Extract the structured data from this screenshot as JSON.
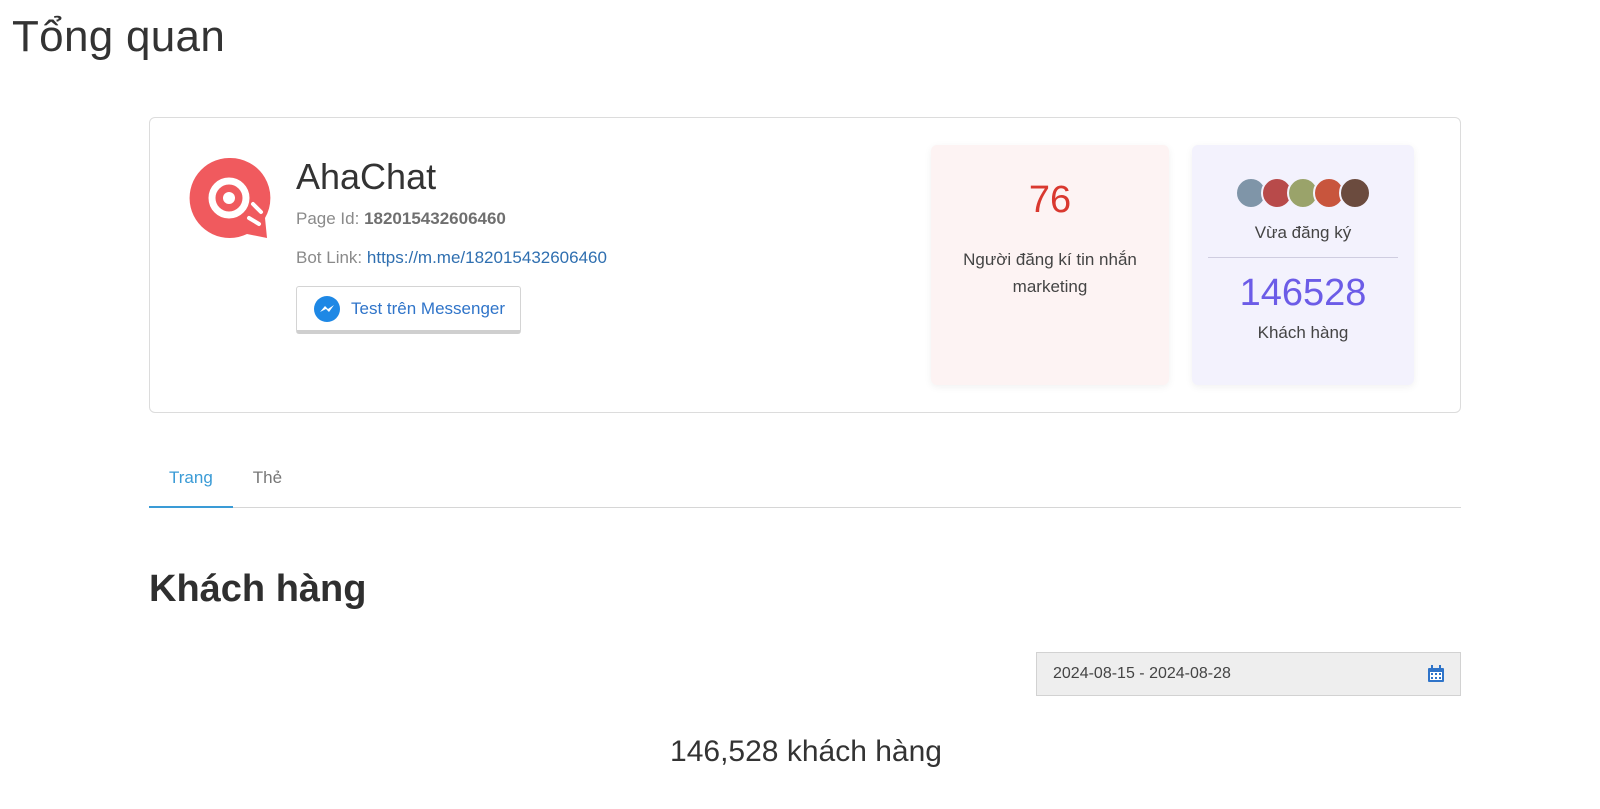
{
  "page": {
    "title": "Tổng quan"
  },
  "bot": {
    "name": "AhaChat",
    "page_id_label": "Page Id:",
    "page_id": "182015432606460",
    "bot_link_label": "Bot Link:",
    "bot_link": "https://m.me/182015432606460",
    "test_button_label": "Test trên Messenger",
    "logo_icon": "ahachat-logo-icon",
    "brand_color": "#f05a5e"
  },
  "stats": {
    "marketing": {
      "value": "76",
      "label": "Người đăng kí tin nhắn marketing",
      "color": "#d9382f"
    },
    "recent": {
      "label": "Vừa đăng ký",
      "avatars": [
        "#7f95a8",
        "#b84a4a",
        "#9aa36a",
        "#c8553d",
        "#6b4b3e"
      ]
    },
    "customers": {
      "value": "146528",
      "label": "Khách hàng",
      "color": "#6c5ce7"
    }
  },
  "tabs": [
    {
      "label": "Trang",
      "active": true
    },
    {
      "label": "Thẻ",
      "active": false
    }
  ],
  "section": {
    "title": "Khách hàng",
    "date_range": "2024-08-15 - 2024-08-28",
    "total_text": "146,528 khách hàng"
  }
}
